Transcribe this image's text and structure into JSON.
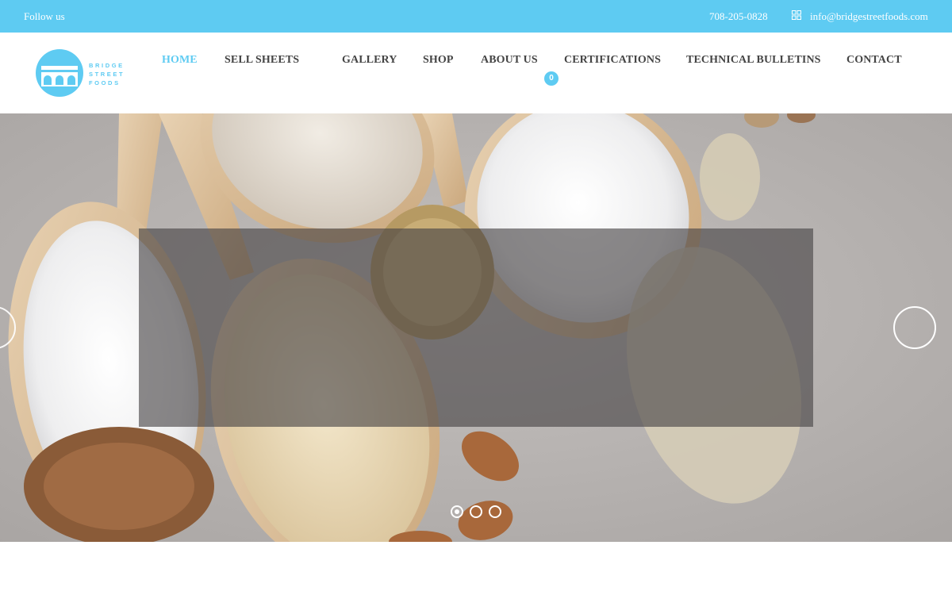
{
  "topbar": {
    "follow_label": "Follow us",
    "phone": "708-205-0828",
    "email": "info@bridgestreetfoods.com",
    "background_color": "#5ecbf2",
    "email_icon": "mail-icon"
  },
  "logo": {
    "line1": "BRIDGE",
    "line2": "STREET",
    "line3": "FOODS",
    "color": "#5ecbf2",
    "icon": "bridge-arches-logo"
  },
  "nav": {
    "items": [
      {
        "label": "HOME",
        "active": true
      },
      {
        "label": "SELL SHEETS",
        "active": false
      },
      {
        "label": "GALLERY",
        "active": false
      },
      {
        "label": "SHOP",
        "active": false
      },
      {
        "label": "ABOUT US",
        "active": false
      },
      {
        "label": "CERTIFICATIONS",
        "active": false
      },
      {
        "label": "TECHNICAL BULLETINS",
        "active": false
      },
      {
        "label": "CONTACT",
        "active": false
      }
    ],
    "cart_count": "0",
    "active_color": "#5ecbf2",
    "text_color": "#444444"
  },
  "hero": {
    "slide_count": 3,
    "active_slide": 1,
    "next_icon": "next-arrow-circle",
    "prev_icon": "prev-arrow-circle"
  }
}
